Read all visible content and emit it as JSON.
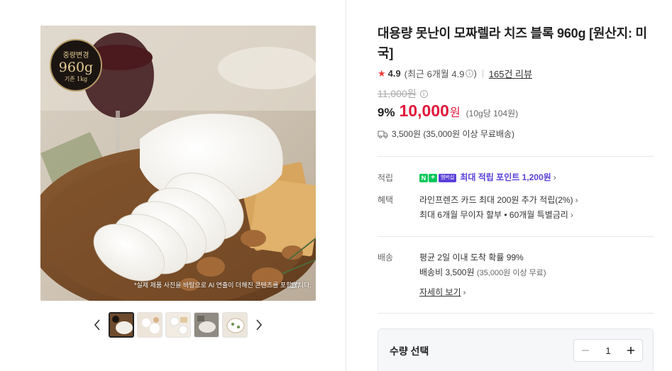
{
  "gallery": {
    "badge": {
      "line1": "중량변경",
      "weight": "960g",
      "line3": "기존 1kg"
    },
    "disclaimer": "*실제 제품 사진을 바탕으로 AI 연출이 더해진 콘텐츠를 포함합니다.",
    "counter": "1/7",
    "thumb_count": 5,
    "active_thumb": 1
  },
  "product": {
    "title": "대용량 못난이 모짜렐라 치즈 블록 960g [원산지: 미국]",
    "rating": "4.9",
    "recent_rating": "(최근 6개월 4.9",
    "review_link": "165건 리뷰",
    "original_price": "11,000원",
    "discount": "9%",
    "price": "10,000",
    "won": "원",
    "unit_price": "(10g당 104원)",
    "shipping": "3,500원 (35,000원 이상 무료배송)"
  },
  "benefits": {
    "points_label": "적립",
    "membership_badge": "멤버십",
    "points_text": "최대 적립 포인트 1,200원",
    "benefit_label": "혜택",
    "benefit_line1": "라인프렌즈 카드 최대 200원 추가 적립(2%)",
    "benefit_line2": "최대 6개월 무이자 할부 • 60개월 특별금리"
  },
  "delivery": {
    "label": "배송",
    "line1": "평균 2일 이내 도착 확률 99%",
    "fee_main": "배송비 3,500원",
    "fee_sub": "(35,000원 이상 무료)",
    "detail_link": "자세히 보기"
  },
  "quantity": {
    "label": "수량 선택",
    "value": "1"
  },
  "colors": {
    "price_red": "#e0173a",
    "star_red": "#f03c3c",
    "membership_purple": "#5a3fd8",
    "naver_green": "#03c75a"
  }
}
